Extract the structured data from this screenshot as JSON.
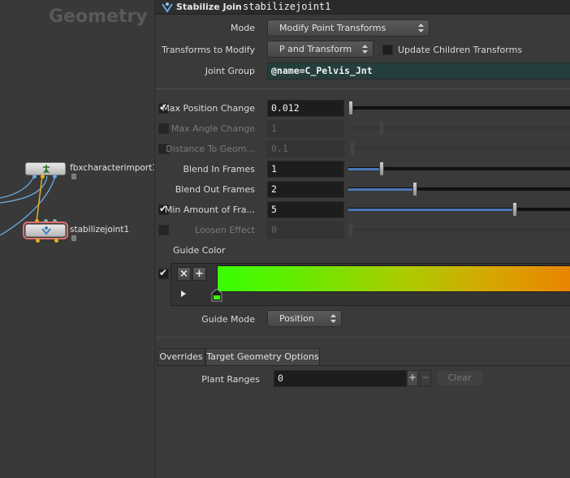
{
  "network": {
    "title": "Geometry",
    "nodes": [
      {
        "label": "fbxcharacterimport1"
      },
      {
        "label": "stabilizejoint1"
      }
    ]
  },
  "header": {
    "node_type": "Stabilize Joint",
    "node_name": "stabilizejoint1"
  },
  "params": {
    "mode": {
      "label": "Mode",
      "value": "Modify Point Transforms"
    },
    "transforms": {
      "label": "Transforms to Modify",
      "value": "P and Transform"
    },
    "update_children": {
      "label": "Update Children Transforms",
      "checked": false
    },
    "joint_group": {
      "label": "Joint Group",
      "value": "@name=C_Pelvis_Jnt"
    },
    "max_position": {
      "label": "Max Position Change",
      "value": "0.012",
      "checked": true,
      "level": 0.0
    },
    "max_angle": {
      "label": "Max Angle Change",
      "value": "1",
      "checked": false,
      "level": 0.15
    },
    "distance": {
      "label": "Distance To Geom...",
      "value": "0.1",
      "checked": false,
      "level": 0.0
    },
    "blend_in": {
      "label": "Blend In Frames",
      "value": "1",
      "level": 0.15
    },
    "blend_out": {
      "label": "Blend Out Frames",
      "value": "2",
      "level": 0.3
    },
    "min_amount": {
      "label": "Min Amount of Fra...",
      "value": "5",
      "checked": true,
      "level": 0.75
    },
    "loosen": {
      "label": "Loosen Effect",
      "value": "0",
      "checked": false,
      "level": 0.0
    },
    "guide_color": {
      "label": "Guide Color",
      "checked": true,
      "remove": "×",
      "add": "+",
      "colors": [
        "#38ff00",
        "#b0c800",
        "#e88500"
      ]
    },
    "guide_mode": {
      "label": "Guide Mode",
      "value": "Position"
    }
  },
  "tabs": [
    {
      "label": "Overrides",
      "active": true
    },
    {
      "label": "Target Geometry Options",
      "active": false
    }
  ],
  "overrides": {
    "plant_ranges": {
      "label": "Plant Ranges",
      "value": "0",
      "add": "+",
      "remove": "−",
      "clear": "Clear"
    }
  }
}
